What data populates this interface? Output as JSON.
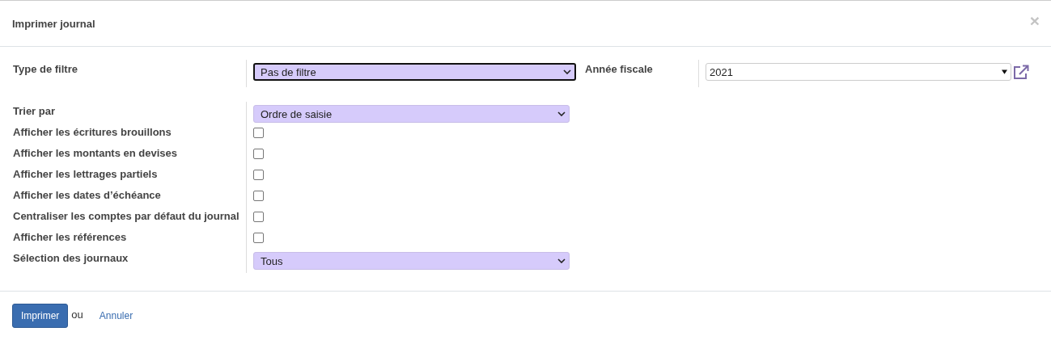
{
  "dialog": {
    "title": "Imprimer journal",
    "close": "×"
  },
  "top_fields": [
    {
      "label": "Type de filtre",
      "kind": "select",
      "value": "Pas de filtre",
      "focused": true
    },
    {
      "label": "Année fiscale",
      "kind": "many2one",
      "value": "2021",
      "focused": false
    }
  ],
  "fields": [
    {
      "label": "Trier par",
      "kind": "select",
      "value": "Ordre de saisie"
    },
    {
      "label": "Afficher les écritures brouillons",
      "kind": "checkbox",
      "checked": false
    },
    {
      "label": "Afficher les montants en devises",
      "kind": "checkbox",
      "checked": false
    },
    {
      "label": "Afficher les lettrages partiels",
      "kind": "checkbox",
      "checked": false
    },
    {
      "label": "Afficher les dates d’échéance",
      "kind": "checkbox",
      "checked": false
    },
    {
      "label": "Centraliser les comptes par défaut du journal",
      "kind": "checkbox",
      "checked": false
    },
    {
      "label": "Afficher les références",
      "kind": "checkbox",
      "checked": false
    },
    {
      "label": "Sélection des journaux",
      "kind": "select",
      "value": "Tous"
    }
  ],
  "footer": {
    "primary": "Imprimer",
    "separator": "ou",
    "cancel": "Annuler"
  }
}
